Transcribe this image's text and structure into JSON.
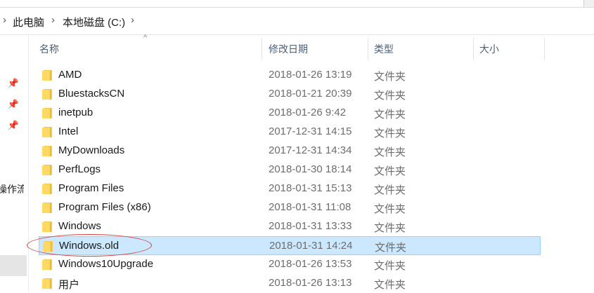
{
  "breadcrumb": [
    "此电脑",
    "本地磁盘 (C:)"
  ],
  "nav_pane": {
    "partial_label": "操作流"
  },
  "columns": [
    {
      "key": "name",
      "label": "名称"
    },
    {
      "key": "date",
      "label": "修改日期"
    },
    {
      "key": "type",
      "label": "类型"
    },
    {
      "key": "size",
      "label": "大小"
    }
  ],
  "icons": {
    "breadcrumb_separator": "chevron-right-icon",
    "pin": "pin-icon",
    "sort": "sort-ascending-icon",
    "folder": "folder-icon"
  },
  "files": [
    {
      "name": "AMD",
      "date": "2018-01-26 13:19",
      "type": "文件夹"
    },
    {
      "name": "BluestacksCN",
      "date": "2018-01-21 20:39",
      "type": "文件夹"
    },
    {
      "name": "inetpub",
      "date": "2018-01-26 9:42",
      "type": "文件夹"
    },
    {
      "name": "Intel",
      "date": "2017-12-31 14:15",
      "type": "文件夹"
    },
    {
      "name": "MyDownloads",
      "date": "2017-12-31 14:34",
      "type": "文件夹"
    },
    {
      "name": "PerfLogs",
      "date": "2018-01-30 18:14",
      "type": "文件夹"
    },
    {
      "name": "Program Files",
      "date": "2018-01-31 15:13",
      "type": "文件夹"
    },
    {
      "name": "Program Files (x86)",
      "date": "2018-01-31 11:08",
      "type": "文件夹"
    },
    {
      "name": "Windows",
      "date": "2018-01-31 13:33",
      "type": "文件夹"
    },
    {
      "name": "Windows.old",
      "date": "2018-01-31 14:24",
      "type": "文件夹",
      "selected": true,
      "highlighted": true
    },
    {
      "name": "Windows10Upgrade",
      "date": "2018-01-26 13:53",
      "type": "文件夹"
    },
    {
      "name": "用户",
      "date": "2018-01-26 13:13",
      "type": "文件夹"
    }
  ],
  "colors": {
    "selection_bg": "#cce8ff",
    "selection_border": "#99d1ff",
    "annotation": "#d24040",
    "folder": "#ffd964",
    "header_text": "#4c607a"
  }
}
